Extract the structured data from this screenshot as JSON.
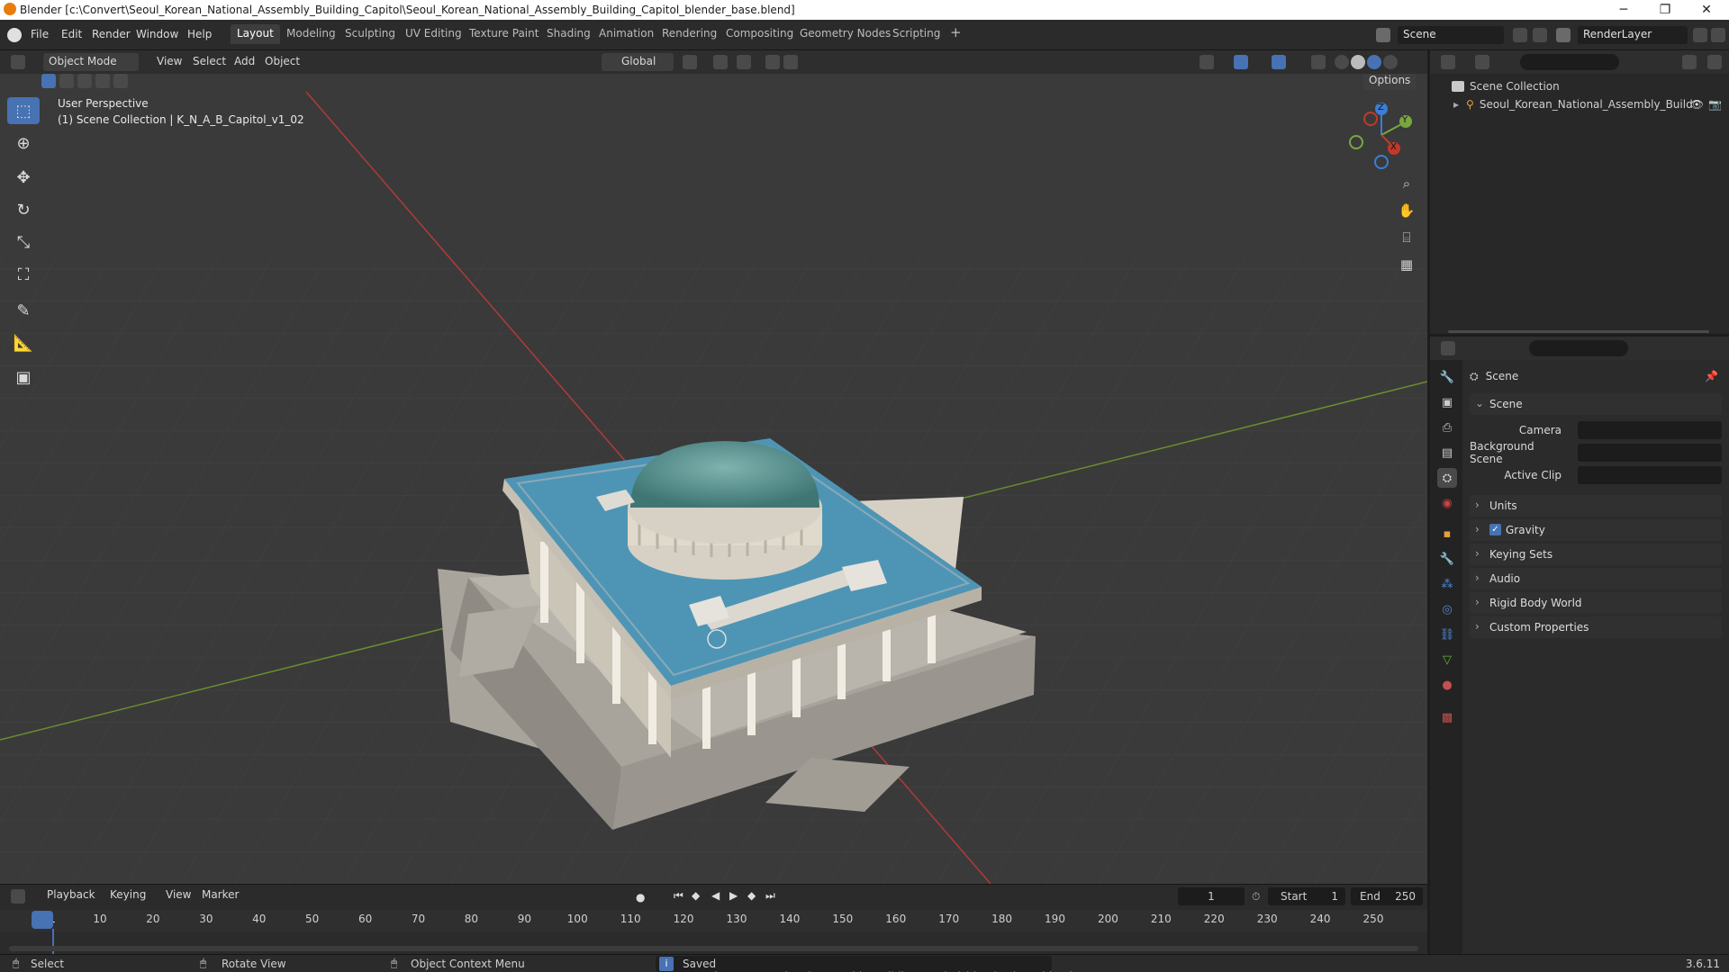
{
  "window": {
    "title": "Blender [c:\\Convert\\Seoul_Korean_National_Assembly_Building_Capitol\\Seoul_Korean_National_Assembly_Building_Capitol_blender_base.blend]",
    "minimize": "─",
    "maximize": "❐",
    "close": "✕"
  },
  "menu": [
    "File",
    "Edit",
    "Render",
    "Window",
    "Help"
  ],
  "workspaces": [
    {
      "label": "Layout",
      "active": true
    },
    {
      "label": "Modeling"
    },
    {
      "label": "Sculpting"
    },
    {
      "label": "UV Editing"
    },
    {
      "label": "Texture Paint"
    },
    {
      "label": "Shading"
    },
    {
      "label": "Animation"
    },
    {
      "label": "Rendering"
    },
    {
      "label": "Compositing"
    },
    {
      "label": "Geometry Nodes"
    },
    {
      "label": "Scripting"
    }
  ],
  "add_workspace": "+",
  "scene_selector": "Scene",
  "renderlayer_selector": "RenderLayer",
  "viewport_header": {
    "mode": "Object Mode",
    "menus": [
      "View",
      "Select",
      "Add",
      "Object"
    ],
    "transform_orientation": "Global",
    "options": "Options"
  },
  "viewport": {
    "perspective": "User Perspective",
    "collection_info": "(1) Scene Collection | K_N_A_B_Capitol_v1_02"
  },
  "gizmo": {
    "x": "X",
    "y": "Y",
    "z": "Z"
  },
  "outliner": {
    "root": "Scene Collection",
    "items": [
      {
        "label": "Seoul_Korean_National_Assembly_Build"
      }
    ]
  },
  "properties": {
    "context_title": "Scene",
    "section_title": "Scene",
    "fields": [
      {
        "label": "Camera"
      },
      {
        "label": "Background Scene"
      },
      {
        "label": "Active Clip"
      }
    ],
    "sections": [
      {
        "label": "Units"
      },
      {
        "label": "Gravity",
        "checked": true
      },
      {
        "label": "Keying Sets"
      },
      {
        "label": "Audio"
      },
      {
        "label": "Rigid Body World"
      },
      {
        "label": "Custom Properties"
      }
    ]
  },
  "timeline": {
    "menus": [
      "Playback",
      "Keying",
      "View",
      "Marker"
    ],
    "current_frame": "1",
    "start_label": "Start",
    "start": "1",
    "end_label": "End",
    "end": "250",
    "ticks": [
      "1",
      "10",
      "20",
      "30",
      "40",
      "50",
      "60",
      "70",
      "80",
      "90",
      "100",
      "110",
      "120",
      "130",
      "140",
      "150",
      "160",
      "170",
      "180",
      "190",
      "200",
      "210",
      "220",
      "230",
      "240",
      "250"
    ]
  },
  "statusbar": {
    "select": "Select",
    "rotate": "Rotate View",
    "context_menu": "Object Context Menu",
    "message": "Saved \"Seoul_Korean_National_Assembly_Building_Capitol_blender_base.blend\"",
    "version": "3.6.11"
  },
  "colors": {
    "accent": "#4772b3",
    "x_axis": "#c0392b",
    "y_axis": "#7aa640",
    "z_axis": "#3b7dd8"
  }
}
